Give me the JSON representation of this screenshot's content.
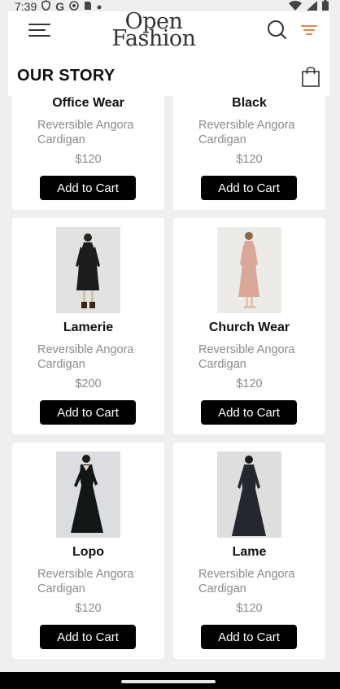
{
  "status_bar": {
    "time": "7:39",
    "icons": [
      "shield-icon",
      "google-icon",
      "sync-icon",
      "sim-icon",
      "dot-icon"
    ],
    "right_icons": [
      "wifi-icon",
      "signal-icon",
      "battery-icon"
    ]
  },
  "header": {
    "logo_line1": "Open",
    "logo_line2": "Fashion",
    "title": "OUR STORY",
    "accent_color": "#e0874c"
  },
  "products": [
    {
      "name": "Office Wear",
      "desc": "Reversible Angora Cardigan",
      "price": "$120",
      "button": "Add to Cart"
    },
    {
      "name": "Black",
      "desc": "Reversible Angora Cardigan",
      "price": "$120",
      "button": "Add to Cart"
    },
    {
      "name": "Lamerie",
      "desc": "Reversible Angora Cardigan",
      "price": "$200",
      "button": "Add to Cart"
    },
    {
      "name": "Church Wear",
      "desc": "Reversible Angora Cardigan",
      "price": "$120",
      "button": "Add to Cart"
    },
    {
      "name": "Lopo",
      "desc": "Reversible Angora Cardigan",
      "price": "$120",
      "button": "Add to Cart"
    },
    {
      "name": "Lame",
      "desc": "Reversible Angora Cardigan",
      "price": "$120",
      "button": "Add to Cart"
    }
  ]
}
